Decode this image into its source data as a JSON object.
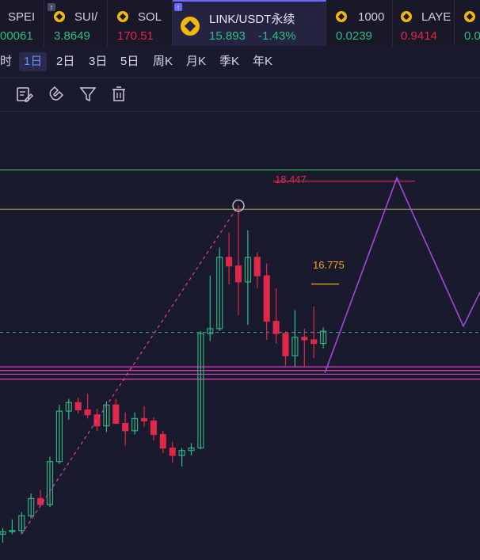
{
  "tickers": [
    {
      "symbol": "SPEI",
      "price": "00061",
      "trend": "up"
    },
    {
      "symbol": "SUI/",
      "price": "3.8649",
      "trend": "up"
    },
    {
      "symbol": "SOL",
      "price": "170.51",
      "trend": "down"
    },
    {
      "symbol": "LINK/USDT永续",
      "price": "15.893",
      "change": "-1.43%",
      "trend": "up"
    },
    {
      "symbol": "1000",
      "price": "0.0239",
      "trend": "up"
    },
    {
      "symbol": "LAYE",
      "price": "0.9414",
      "trend": "down"
    },
    {
      "symbol": "",
      "price": "0.0",
      "trend": "up"
    }
  ],
  "periods": [
    "时",
    "1日",
    "2日",
    "3日",
    "5日",
    "周K",
    "月K",
    "季K",
    "年K"
  ],
  "selected_period": "1日",
  "toolbar": {
    "icons": [
      "edit-icon",
      "magnet-icon",
      "filter-icon",
      "trash-icon"
    ]
  },
  "chart": {
    "label_high": "18.447",
    "label_mid": "16.775",
    "colors": {
      "up": "#2ebd85",
      "down": "#e0294a",
      "projection": "#a04ad6",
      "support": "#e040c0",
      "resistance_green": "#35c24a",
      "resistance_olive": "#8a8a3a",
      "label_high": "#e0294a",
      "label_mid": "#f5a623"
    }
  },
  "chart_data": {
    "type": "candlestick",
    "candles": [
      {
        "o": 12.62,
        "h": 12.72,
        "l": 12.48,
        "c": 12.66
      },
      {
        "o": 12.66,
        "h": 12.86,
        "l": 12.62,
        "c": 12.68
      },
      {
        "o": 12.68,
        "h": 12.98,
        "l": 12.62,
        "c": 12.92
      },
      {
        "o": 12.92,
        "h": 13.28,
        "l": 12.88,
        "c": 13.2
      },
      {
        "o": 13.2,
        "h": 13.34,
        "l": 13.08,
        "c": 13.1
      },
      {
        "o": 13.1,
        "h": 13.88,
        "l": 13.06,
        "c": 13.8
      },
      {
        "o": 13.8,
        "h": 14.72,
        "l": 13.76,
        "c": 14.62
      },
      {
        "o": 14.62,
        "h": 14.82,
        "l": 14.48,
        "c": 14.76
      },
      {
        "o": 14.76,
        "h": 14.84,
        "l": 14.58,
        "c": 14.64
      },
      {
        "o": 14.64,
        "h": 14.9,
        "l": 14.5,
        "c": 14.56
      },
      {
        "o": 14.56,
        "h": 14.66,
        "l": 14.3,
        "c": 14.38
      },
      {
        "o": 14.38,
        "h": 14.78,
        "l": 14.28,
        "c": 14.72
      },
      {
        "o": 14.72,
        "h": 14.82,
        "l": 14.58,
        "c": 14.42
      },
      {
        "o": 14.42,
        "h": 14.6,
        "l": 14.06,
        "c": 14.3
      },
      {
        "o": 14.3,
        "h": 14.6,
        "l": 14.24,
        "c": 14.5
      },
      {
        "o": 14.5,
        "h": 14.7,
        "l": 14.36,
        "c": 14.46
      },
      {
        "o": 14.46,
        "h": 14.52,
        "l": 14.14,
        "c": 14.24
      },
      {
        "o": 14.24,
        "h": 14.3,
        "l": 13.94,
        "c": 14.02
      },
      {
        "o": 14.02,
        "h": 14.12,
        "l": 13.78,
        "c": 13.9
      },
      {
        "o": 13.9,
        "h": 14.02,
        "l": 13.72,
        "c": 13.98
      },
      {
        "o": 13.98,
        "h": 14.1,
        "l": 13.9,
        "c": 14.02
      },
      {
        "o": 14.02,
        "h": 15.92,
        "l": 14.0,
        "c": 15.88
      },
      {
        "o": 15.88,
        "h": 16.82,
        "l": 15.76,
        "c": 15.96
      },
      {
        "o": 15.96,
        "h": 17.28,
        "l": 15.92,
        "c": 17.12
      },
      {
        "o": 17.12,
        "h": 17.52,
        "l": 16.68,
        "c": 16.98
      },
      {
        "o": 16.98,
        "h": 17.96,
        "l": 16.18,
        "c": 16.72
      },
      {
        "o": 16.72,
        "h": 17.56,
        "l": 16.02,
        "c": 17.12
      },
      {
        "o": 17.12,
        "h": 17.2,
        "l": 16.62,
        "c": 16.82
      },
      {
        "o": 16.82,
        "h": 17.02,
        "l": 15.78,
        "c": 16.08
      },
      {
        "o": 16.08,
        "h": 16.62,
        "l": 15.72,
        "c": 15.88
      },
      {
        "o": 15.88,
        "h": 15.92,
        "l": 15.36,
        "c": 15.52
      },
      {
        "o": 15.52,
        "h": 16.26,
        "l": 15.34,
        "c": 15.82
      },
      {
        "o": 15.82,
        "h": 15.96,
        "l": 15.34,
        "c": 15.78
      },
      {
        "o": 15.78,
        "h": 16.32,
        "l": 15.48,
        "c": 15.72
      },
      {
        "o": 15.72,
        "h": 15.98,
        "l": 15.64,
        "c": 15.92
      }
    ],
    "horizontal_lines": [
      {
        "price": 18.54,
        "color": "#35c24a"
      },
      {
        "price": 17.9,
        "color": "#8a8a3a"
      },
      {
        "price": 15.9,
        "color": "#4fd1c5",
        "dashed": true
      },
      {
        "price": 15.34,
        "color": "#e040c0"
      },
      {
        "price": 15.28,
        "color": "#e040c0"
      },
      {
        "price": 15.22,
        "color": "#e040c0"
      },
      {
        "price": 15.14,
        "color": "#e040c0"
      }
    ],
    "price_labels": [
      {
        "text": "18.447",
        "price": 18.447
      },
      {
        "text": "16.775",
        "price": 16.775
      }
    ],
    "ylim": [
      12.2,
      19.5
    ]
  }
}
